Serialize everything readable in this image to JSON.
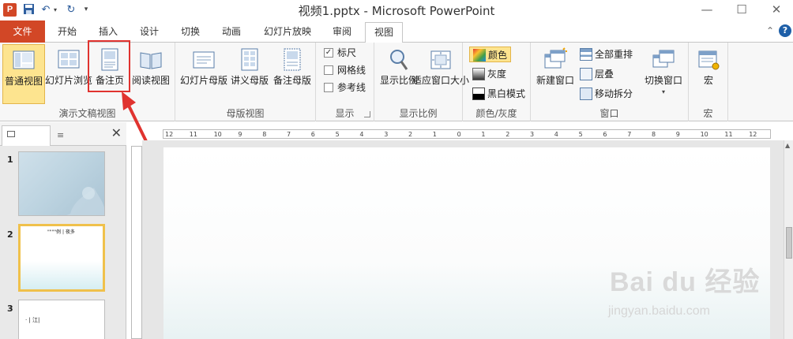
{
  "window": {
    "title": "视频1.pptx - Microsoft PowerPoint",
    "app_icon_letter": "P",
    "controls": {
      "minimize": "—",
      "maximize": "☐",
      "close": "✕"
    }
  },
  "quick_access": {
    "save_icon": "save-icon",
    "undo_icon": "undo-icon",
    "redo_icon": "redo-icon"
  },
  "tabs": [
    {
      "label": "文件"
    },
    {
      "label": "开始"
    },
    {
      "label": "插入"
    },
    {
      "label": "设计"
    },
    {
      "label": "切换"
    },
    {
      "label": "动画"
    },
    {
      "label": "幻灯片放映"
    },
    {
      "label": "审阅"
    },
    {
      "label": "视图"
    }
  ],
  "ribbon": {
    "presentation_views": {
      "group_label": "演示文稿视图",
      "normal": "普通视图",
      "slide_sorter": "幻灯片浏览",
      "notes_page": "备注页",
      "reading": "阅读视图"
    },
    "master_views": {
      "group_label": "母版视图",
      "slide_master": "幻灯片母版",
      "handout_master": "讲义母版",
      "notes_master": "备注母版"
    },
    "show": {
      "group_label": "显示",
      "ruler": "标尺",
      "gridlines": "网格线",
      "guides": "参考线",
      "ruler_checked": true
    },
    "zoom": {
      "group_label": "显示比例",
      "zoom": "显示比例",
      "fit_window": "适应窗口大小"
    },
    "color": {
      "group_label": "颜色/灰度",
      "color": "颜色",
      "grayscale": "灰度",
      "black_white": "黑白模式"
    },
    "window": {
      "group_label": "窗口",
      "new_window": "新建窗口",
      "arrange_all": "全部重排",
      "cascade": "层叠",
      "move_split": "移动拆分",
      "switch_windows": "切换窗口"
    },
    "macros": {
      "group_label": "宏",
      "macros": "宏"
    }
  },
  "slides_pane": {
    "slides": [
      {
        "number": "1",
        "text": ""
      },
      {
        "number": "2",
        "text": "\"\"\"\"例 | 夜多"
      },
      {
        "number": "3",
        "text": "· | 江|"
      }
    ]
  },
  "ruler_labels": [
    "12",
    "11",
    "10",
    "9",
    "8",
    "7",
    "6",
    "5",
    "4",
    "3",
    "2",
    "1",
    "0",
    "1",
    "2",
    "3",
    "4",
    "5",
    "6",
    "7",
    "8",
    "9",
    "10",
    "11",
    "12"
  ],
  "watermark": {
    "brand": "Bai du 经验",
    "url": "jingyan.baidu.com"
  },
  "colors": {
    "file_tab": "#d24726",
    "selected": "#fde48f",
    "highlight": "#e0332f"
  }
}
